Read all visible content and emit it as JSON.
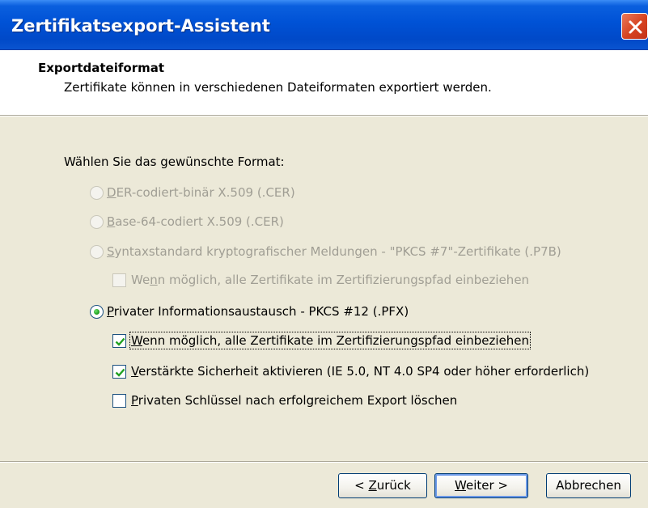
{
  "window": {
    "title": "Zertifikatsexport-Assistent"
  },
  "header": {
    "title": "Exportdateiformat",
    "subtitle": "Zertifikate können in verschiedenen Dateiformaten exportiert werden."
  },
  "body": {
    "prompt": "Wählen Sie das gewünschte Format:",
    "options": [
      {
        "key": "D",
        "rest": "ER-codiert-binär X.509 (.CER)",
        "enabled": false,
        "selected": false
      },
      {
        "key": "B",
        "rest": "ase-64-codiert X.509 (.CER)",
        "enabled": false,
        "selected": false
      },
      {
        "key": "S",
        "rest": "yntaxstandard kryptografischer Meldungen - \"PKCS #7\"-Zertifikate (.P7B)",
        "enabled": false,
        "selected": false
      },
      {
        "key": "P",
        "rest": "rivater Informationsaustausch - PKCS #12 (.PFX)",
        "enabled": true,
        "selected": true
      }
    ],
    "p7b_include_chain": {
      "pre": "We",
      "key": "n",
      "rest": "n möglich, alle Zertifikate im Zertifizierungspfad einbeziehen",
      "checked": false,
      "enabled": false
    },
    "pfx_include_chain": {
      "key": "W",
      "rest": "enn möglich, alle Zertifikate im Zertifizierungspfad einbeziehen",
      "checked": true
    },
    "strong_protection": {
      "key": "V",
      "rest": "erstärkte Sicherheit aktivieren (IE 5.0, NT 4.0 SP4 oder höher erforderlich)",
      "checked": true
    },
    "delete_private_key": {
      "key": "P",
      "rest": "rivaten Schlüssel nach erfolgreichem Export löschen",
      "checked": false
    }
  },
  "buttons": {
    "back": {
      "pre": "< ",
      "key": "Z",
      "rest": "urück"
    },
    "next": {
      "key": "W",
      "rest": "eiter >"
    },
    "cancel": "Abbrechen"
  },
  "colors": {
    "titlebar": "#0052d6",
    "dialog_bg": "#ece9d8",
    "disabled_text": "#a09e94",
    "checkmark": "#21a121"
  }
}
